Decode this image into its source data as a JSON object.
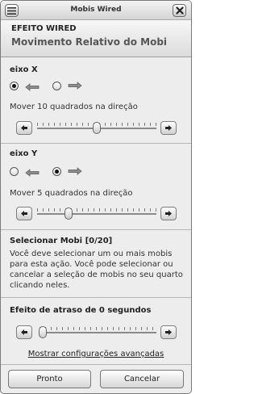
{
  "window": {
    "title": "Mobis Wired"
  },
  "header": {
    "line1": "EFEITO WIRED",
    "line2": "Movimento Relativo do Mobi"
  },
  "axis_x": {
    "title": "eixo X",
    "selected": "left",
    "options": [
      {
        "icon": "arrow-left-icon",
        "checked": true
      },
      {
        "icon": "arrow-right-icon",
        "checked": false
      }
    ],
    "label": "Mover 10 quadrados na direção",
    "slider": {
      "value": 10,
      "min": 0,
      "max": 20,
      "fraction": 0.5
    }
  },
  "axis_y": {
    "title": "eixo Y",
    "selected": "right",
    "options": [
      {
        "icon": "arrow-left-icon",
        "checked": false
      },
      {
        "icon": "arrow-right-icon",
        "checked": true
      }
    ],
    "label": "Mover 5 quadrados na direção",
    "slider": {
      "value": 5,
      "min": 0,
      "max": 20,
      "fraction": 0.25
    }
  },
  "select_mobi": {
    "title": "Selecionar Mobi [0/20]",
    "text_lines": [
      "Você deve selecionar um ou mais mobis",
      "para esta ação. Você pode selecionar ou",
      "cancelar a seleção de mobis no seu quarto",
      "clicando neles."
    ]
  },
  "delay": {
    "title": "Efeito de atraso de 0 segundos",
    "slider": {
      "value": 0,
      "fraction": 0.0
    }
  },
  "advanced_link": "Mostrar configurações avançadas",
  "buttons": {
    "ok": "Pronto",
    "cancel": "Cancelar"
  }
}
